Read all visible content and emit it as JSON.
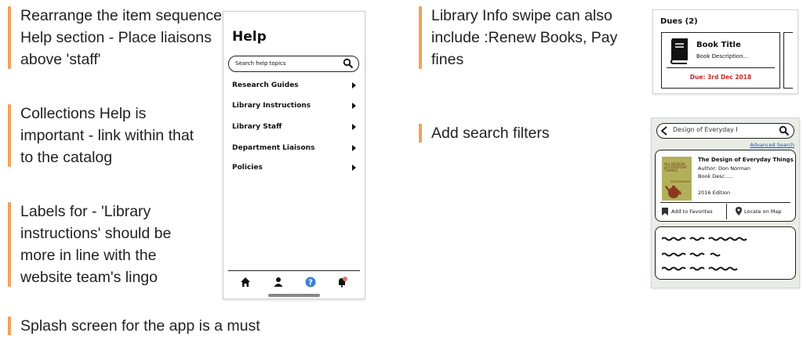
{
  "notes": [
    {
      "text": "Rearrange the item sequence: Help section - Place liaisons above 'staff'"
    },
    {
      "text": "Collections Help is important - link within that to the catalog"
    },
    {
      "text": "Labels for - 'Library instructions' should be more in line with the website team's lingo"
    },
    {
      "text": "Splash screen for the app is a must"
    },
    {
      "text": "Library Info swipe can also include :Renew Books, Pay fines"
    },
    {
      "text": "Add search filters"
    }
  ],
  "colors": {
    "note_bar": "#f3a257",
    "due": "#c62828",
    "link": "#1e4fb0",
    "help_icon": "#3d7fd6",
    "notification_dot": "#e57373"
  },
  "help_screen": {
    "title": "Help",
    "search_placeholder": "Search help topics",
    "items": [
      {
        "label": "Research Guides"
      },
      {
        "label": "Library Instructions"
      },
      {
        "label": "Library Staff"
      },
      {
        "label": "Department Liaisons"
      },
      {
        "label": "Policies"
      }
    ],
    "nav_icons": [
      "home-icon",
      "user-icon",
      "help-icon",
      "bell-icon"
    ]
  },
  "dues_card": {
    "title": "Dues (2)",
    "book_title": "Book Title",
    "book_description": "Book Description...",
    "due": "Due: 3rd Dec 2018"
  },
  "search_screen": {
    "query": "Design of Everyday I",
    "advanced_search": "Advanced Search",
    "cover_lines": [
      "the DESIGN",
      "of EVERYDAY",
      "THINGS"
    ],
    "cover_author": "DON NORMAN",
    "result": {
      "title": "The Design of Everyday Things",
      "author": "Author: Don Norman",
      "description": "Book Desc.....",
      "edition": "2016 Edition"
    },
    "add_favorites": "Add to Favorites",
    "locate_map": "Locate on Map"
  }
}
